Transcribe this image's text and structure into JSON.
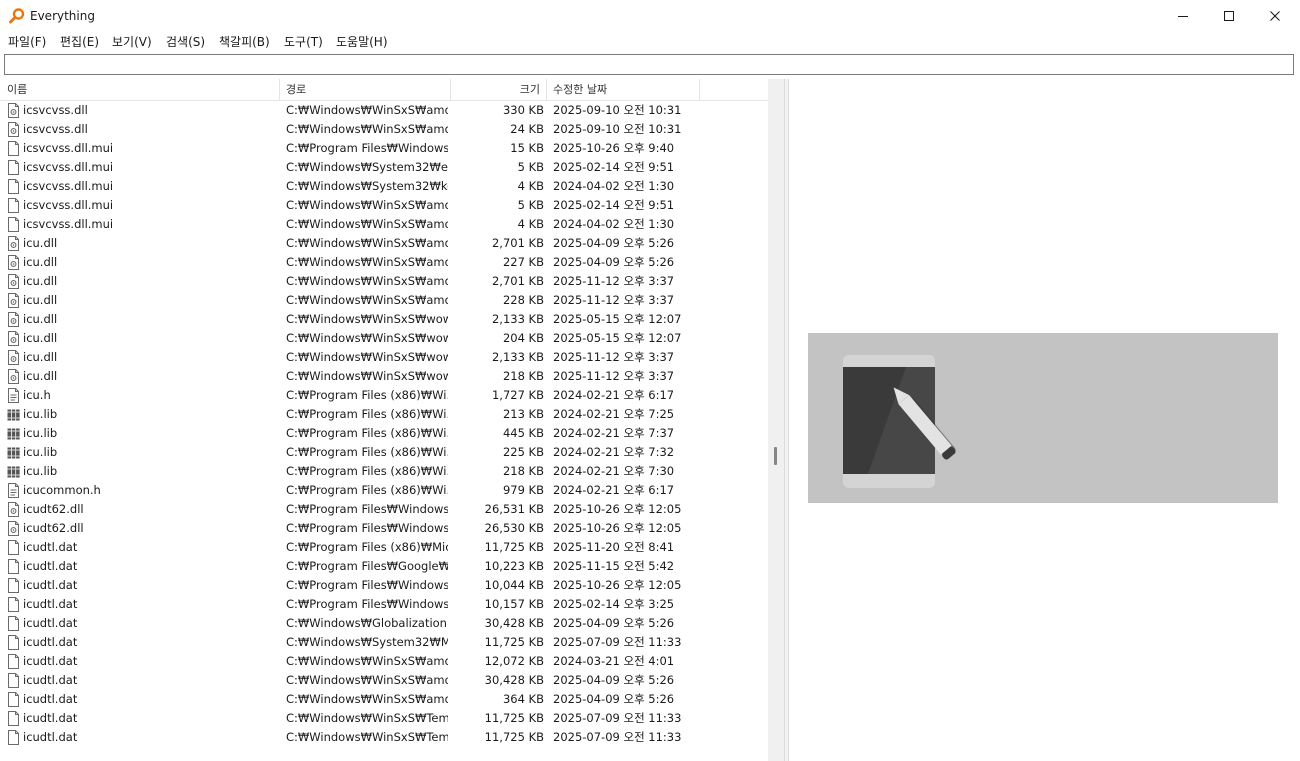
{
  "window": {
    "title": "Everything",
    "controls": {
      "minimize": "minimize-icon",
      "maximize": "maximize-icon",
      "close": "close-icon"
    }
  },
  "menu": [
    "파일(F)",
    "편집(E)",
    "보기(V)",
    "검색(S)",
    "책갈피(B)",
    "도구(T)",
    "도움말(H)"
  ],
  "search": {
    "value": "",
    "placeholder": ""
  },
  "columns": {
    "name": "이름",
    "path": "경로",
    "size": "크기",
    "modified": "수정한 날짜"
  },
  "files": [
    {
      "name": "icsvcvss.dll",
      "path": "C:₩Windows₩WinSxS₩amd...",
      "size": "330 KB",
      "modified": "2025-09-10 오전 10:31",
      "icon": "dll-icon"
    },
    {
      "name": "icsvcvss.dll",
      "path": "C:₩Windows₩WinSxS₩amd...",
      "size": "24 KB",
      "modified": "2025-09-10 오전 10:31",
      "icon": "dll-icon"
    },
    {
      "name": "icsvcvss.dll.mui",
      "path": "C:₩Program Files₩Windows...",
      "size": "15 KB",
      "modified": "2025-10-26 오후 9:40",
      "icon": "file-icon"
    },
    {
      "name": "icsvcvss.dll.mui",
      "path": "C:₩Windows₩System32₩en...",
      "size": "5 KB",
      "modified": "2025-02-14 오전 9:51",
      "icon": "file-icon"
    },
    {
      "name": "icsvcvss.dll.mui",
      "path": "C:₩Windows₩System32₩ko...",
      "size": "4 KB",
      "modified": "2024-04-02 오전 1:30",
      "icon": "file-icon"
    },
    {
      "name": "icsvcvss.dll.mui",
      "path": "C:₩Windows₩WinSxS₩amd...",
      "size": "5 KB",
      "modified": "2025-02-14 오전 9:51",
      "icon": "file-icon"
    },
    {
      "name": "icsvcvss.dll.mui",
      "path": "C:₩Windows₩WinSxS₩amd...",
      "size": "4 KB",
      "modified": "2024-04-02 오전 1:30",
      "icon": "file-icon"
    },
    {
      "name": "icu.dll",
      "path": "C:₩Windows₩WinSxS₩amd...",
      "size": "2,701 KB",
      "modified": "2025-04-09 오후 5:26",
      "icon": "dll-icon"
    },
    {
      "name": "icu.dll",
      "path": "C:₩Windows₩WinSxS₩amd...",
      "size": "227 KB",
      "modified": "2025-04-09 오후 5:26",
      "icon": "dll-icon"
    },
    {
      "name": "icu.dll",
      "path": "C:₩Windows₩WinSxS₩amd...",
      "size": "2,701 KB",
      "modified": "2025-11-12 오후 3:37",
      "icon": "dll-icon"
    },
    {
      "name": "icu.dll",
      "path": "C:₩Windows₩WinSxS₩amd...",
      "size": "228 KB",
      "modified": "2025-11-12 오후 3:37",
      "icon": "dll-icon"
    },
    {
      "name": "icu.dll",
      "path": "C:₩Windows₩WinSxS₩wow...",
      "size": "2,133 KB",
      "modified": "2025-05-15 오후 12:07",
      "icon": "dll-icon"
    },
    {
      "name": "icu.dll",
      "path": "C:₩Windows₩WinSxS₩wow...",
      "size": "204 KB",
      "modified": "2025-05-15 오후 12:07",
      "icon": "dll-icon"
    },
    {
      "name": "icu.dll",
      "path": "C:₩Windows₩WinSxS₩wow...",
      "size": "2,133 KB",
      "modified": "2025-11-12 오후 3:37",
      "icon": "dll-icon"
    },
    {
      "name": "icu.dll",
      "path": "C:₩Windows₩WinSxS₩wow...",
      "size": "218 KB",
      "modified": "2025-11-12 오후 3:37",
      "icon": "dll-icon"
    },
    {
      "name": "icu.h",
      "path": "C:₩Program Files (x86)₩Wi...",
      "size": "1,727 KB",
      "modified": "2024-02-21 오후 6:17",
      "icon": "header-file-icon"
    },
    {
      "name": "icu.lib",
      "path": "C:₩Program Files (x86)₩Wi...",
      "size": "213 KB",
      "modified": "2024-02-21 오후 7:25",
      "icon": "library-icon"
    },
    {
      "name": "icu.lib",
      "path": "C:₩Program Files (x86)₩Wi...",
      "size": "445 KB",
      "modified": "2024-02-21 오후 7:37",
      "icon": "library-icon"
    },
    {
      "name": "icu.lib",
      "path": "C:₩Program Files (x86)₩Wi...",
      "size": "225 KB",
      "modified": "2024-02-21 오후 7:32",
      "icon": "library-icon"
    },
    {
      "name": "icu.lib",
      "path": "C:₩Program Files (x86)₩Wi...",
      "size": "218 KB",
      "modified": "2024-02-21 오후 7:30",
      "icon": "library-icon"
    },
    {
      "name": "icucommon.h",
      "path": "C:₩Program Files (x86)₩Wi...",
      "size": "979 KB",
      "modified": "2024-02-21 오후 6:17",
      "icon": "header-file-icon"
    },
    {
      "name": "icudt62.dll",
      "path": "C:₩Program Files₩Windows...",
      "size": "26,531 KB",
      "modified": "2025-10-26 오후 12:05",
      "icon": "dll-icon"
    },
    {
      "name": "icudt62.dll",
      "path": "C:₩Program Files₩Windows...",
      "size": "26,530 KB",
      "modified": "2025-10-26 오후 12:05",
      "icon": "dll-icon"
    },
    {
      "name": "icudtl.dat",
      "path": "C:₩Program Files (x86)₩Mic...",
      "size": "11,725 KB",
      "modified": "2025-11-20 오전 8:41",
      "icon": "file-icon"
    },
    {
      "name": "icudtl.dat",
      "path": "C:₩Program Files₩Google₩...",
      "size": "10,223 KB",
      "modified": "2025-11-15 오전 5:42",
      "icon": "file-icon"
    },
    {
      "name": "icudtl.dat",
      "path": "C:₩Program Files₩Windows...",
      "size": "10,044 KB",
      "modified": "2025-10-26 오후 12:05",
      "icon": "file-icon"
    },
    {
      "name": "icudtl.dat",
      "path": "C:₩Program Files₩Windows...",
      "size": "10,157 KB",
      "modified": "2025-02-14 오후 3:25",
      "icon": "file-icon"
    },
    {
      "name": "icudtl.dat",
      "path": "C:₩Windows₩Globalization...",
      "size": "30,428 KB",
      "modified": "2025-04-09 오후 5:26",
      "icon": "file-icon"
    },
    {
      "name": "icudtl.dat",
      "path": "C:₩Windows₩System32₩Mi...",
      "size": "11,725 KB",
      "modified": "2025-07-09 오전 11:33",
      "icon": "file-icon"
    },
    {
      "name": "icudtl.dat",
      "path": "C:₩Windows₩WinSxS₩amd...",
      "size": "12,072 KB",
      "modified": "2024-03-21 오전 4:01",
      "icon": "file-icon"
    },
    {
      "name": "icudtl.dat",
      "path": "C:₩Windows₩WinSxS₩amd...",
      "size": "30,428 KB",
      "modified": "2025-04-09 오후 5:26",
      "icon": "file-icon"
    },
    {
      "name": "icudtl.dat",
      "path": "C:₩Windows₩WinSxS₩amd...",
      "size": "364 KB",
      "modified": "2025-04-09 오후 5:26",
      "icon": "file-icon"
    },
    {
      "name": "icudtl.dat",
      "path": "C:₩Windows₩WinSxS₩Tem...",
      "size": "11,725 KB",
      "modified": "2025-07-09 오전 11:33",
      "icon": "file-icon"
    },
    {
      "name": "icudtl.dat",
      "path": "C:₩Windows₩WinSxS₩Tem...",
      "size": "11,725 KB",
      "modified": "2025-07-09 오전 11:33",
      "icon": "file-icon"
    }
  ],
  "preview": {
    "icon": "tablet-pen-placeholder-icon"
  }
}
